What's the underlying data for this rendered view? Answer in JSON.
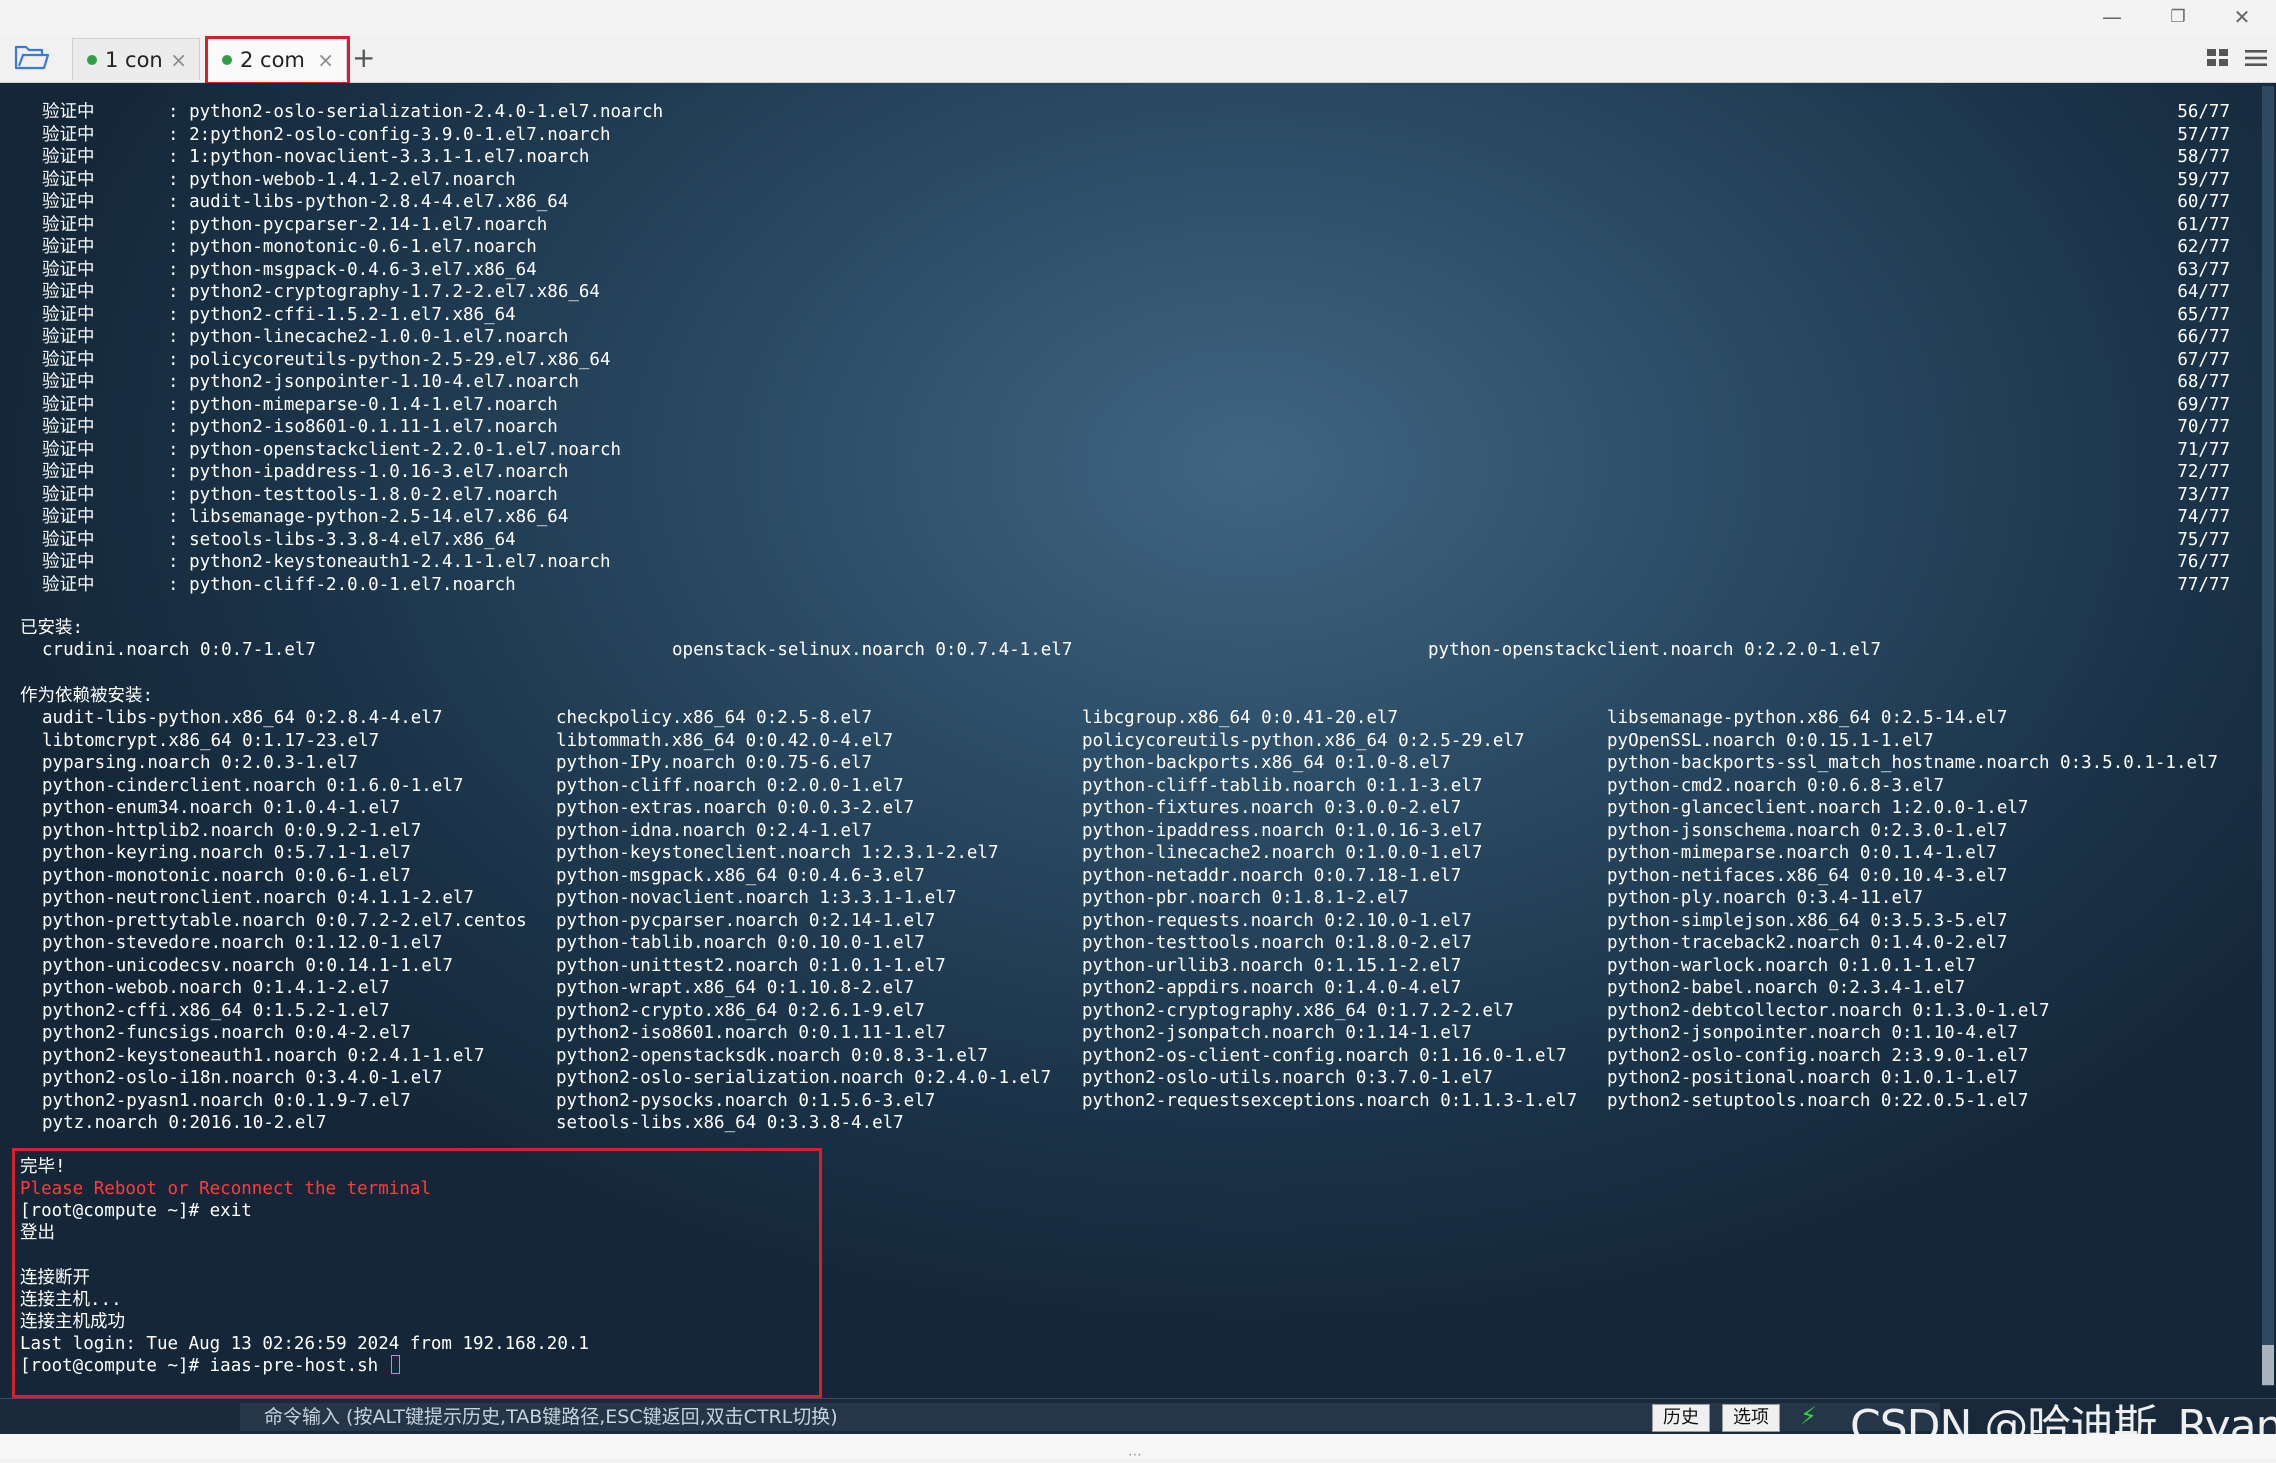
{
  "window": {
    "minimize_icon": "—",
    "restore_icon": "❐",
    "close_icon": "✕"
  },
  "tabs": [
    {
      "label": "1 con",
      "status_color": "#2ea043",
      "active": false
    },
    {
      "label": "2 com",
      "status_color": "#2ea043",
      "active": true
    }
  ],
  "tab_close_glyph": "×",
  "add_tab_glyph": "+",
  "terminal": {
    "verify_lines": [
      {
        "prefix": "验证中",
        "package": ": python2-oslo-serialization-2.4.0-1.el7.noarch",
        "count": "56/77"
      },
      {
        "prefix": "验证中",
        "package": ": 2:python2-oslo-config-3.9.0-1.el7.noarch",
        "count": "57/77"
      },
      {
        "prefix": "验证中",
        "package": ": 1:python-novaclient-3.3.1-1.el7.noarch",
        "count": "58/77"
      },
      {
        "prefix": "验证中",
        "package": ": python-webob-1.4.1-2.el7.noarch",
        "count": "59/77"
      },
      {
        "prefix": "验证中",
        "package": ": audit-libs-python-2.8.4-4.el7.x86_64",
        "count": "60/77"
      },
      {
        "prefix": "验证中",
        "package": ": python-pycparser-2.14-1.el7.noarch",
        "count": "61/77"
      },
      {
        "prefix": "验证中",
        "package": ": python-monotonic-0.6-1.el7.noarch",
        "count": "62/77"
      },
      {
        "prefix": "验证中",
        "package": ": python-msgpack-0.4.6-3.el7.x86_64",
        "count": "63/77"
      },
      {
        "prefix": "验证中",
        "package": ": python2-cryptography-1.7.2-2.el7.x86_64",
        "count": "64/77"
      },
      {
        "prefix": "验证中",
        "package": ": python2-cffi-1.5.2-1.el7.x86_64",
        "count": "65/77"
      },
      {
        "prefix": "验证中",
        "package": ": python-linecache2-1.0.0-1.el7.noarch",
        "count": "66/77"
      },
      {
        "prefix": "验证中",
        "package": ": policycoreutils-python-2.5-29.el7.x86_64",
        "count": "67/77"
      },
      {
        "prefix": "验证中",
        "package": ": python2-jsonpointer-1.10-4.el7.noarch",
        "count": "68/77"
      },
      {
        "prefix": "验证中",
        "package": ": python-mimeparse-0.1.4-1.el7.noarch",
        "count": "69/77"
      },
      {
        "prefix": "验证中",
        "package": ": python2-iso8601-0.1.11-1.el7.noarch",
        "count": "70/77"
      },
      {
        "prefix": "验证中",
        "package": ": python-openstackclient-2.2.0-1.el7.noarch",
        "count": "71/77"
      },
      {
        "prefix": "验证中",
        "package": ": python-ipaddress-1.0.16-3.el7.noarch",
        "count": "72/77"
      },
      {
        "prefix": "验证中",
        "package": ": python-testtools-1.8.0-2.el7.noarch",
        "count": "73/77"
      },
      {
        "prefix": "验证中",
        "package": ": libsemanage-python-2.5-14.el7.x86_64",
        "count": "74/77"
      },
      {
        "prefix": "验证中",
        "package": ": setools-libs-3.3.8-4.el7.x86_64",
        "count": "75/77"
      },
      {
        "prefix": "验证中",
        "package": ": python2-keystoneauth1-2.4.1-1.el7.noarch",
        "count": "76/77"
      },
      {
        "prefix": "验证中",
        "package": ": python-cliff-2.0.0-1.el7.noarch",
        "count": "77/77"
      }
    ],
    "installed_header": "已安装:",
    "installed": [
      "crudini.noarch 0:0.7-1.el7",
      "openstack-selinux.noarch 0:0.7.4-1.el7",
      "python-openstackclient.noarch 0:2.2.0-1.el7"
    ],
    "dependency_header": "作为依赖被安装:",
    "dependency_rows": [
      [
        "audit-libs-python.x86_64 0:2.8.4-4.el7",
        "checkpolicy.x86_64 0:2.5-8.el7",
        "libcgroup.x86_64 0:0.41-20.el7",
        "libsemanage-python.x86_64 0:2.5-14.el7"
      ],
      [
        "libtomcrypt.x86_64 0:1.17-23.el7",
        "libtommath.x86_64 0:0.42.0-4.el7",
        "policycoreutils-python.x86_64 0:2.5-29.el7",
        "pyOpenSSL.noarch 0:0.15.1-1.el7"
      ],
      [
        "pyparsing.noarch 0:2.0.3-1.el7",
        "python-IPy.noarch 0:0.75-6.el7",
        "python-backports.x86_64 0:1.0-8.el7",
        "python-backports-ssl_match_hostname.noarch 0:3.5.0.1-1.el7"
      ],
      [
        "python-cinderclient.noarch 0:1.6.0-1.el7",
        "python-cliff.noarch 0:2.0.0-1.el7",
        "python-cliff-tablib.noarch 0:1.1-3.el7",
        "python-cmd2.noarch 0:0.6.8-3.el7"
      ],
      [
        "python-enum34.noarch 0:1.0.4-1.el7",
        "python-extras.noarch 0:0.0.3-2.el7",
        "python-fixtures.noarch 0:3.0.0-2.el7",
        "python-glanceclient.noarch 1:2.0.0-1.el7"
      ],
      [
        "python-httplib2.noarch 0:0.9.2-1.el7",
        "python-idna.noarch 0:2.4-1.el7",
        "python-ipaddress.noarch 0:1.0.16-3.el7",
        "python-jsonschema.noarch 0:2.3.0-1.el7"
      ],
      [
        "python-keyring.noarch 0:5.7.1-1.el7",
        "python-keystoneclient.noarch 1:2.3.1-2.el7",
        "python-linecache2.noarch 0:1.0.0-1.el7",
        "python-mimeparse.noarch 0:0.1.4-1.el7"
      ],
      [
        "python-monotonic.noarch 0:0.6-1.el7",
        "python-msgpack.x86_64 0:0.4.6-3.el7",
        "python-netaddr.noarch 0:0.7.18-1.el7",
        "python-netifaces.x86_64 0:0.10.4-3.el7"
      ],
      [
        "python-neutronclient.noarch 0:4.1.1-2.el7",
        "python-novaclient.noarch 1:3.3.1-1.el7",
        "python-pbr.noarch 0:1.8.1-2.el7",
        "python-ply.noarch 0:3.4-11.el7"
      ],
      [
        "python-prettytable.noarch 0:0.7.2-2.el7.centos",
        "python-pycparser.noarch 0:2.14-1.el7",
        "python-requests.noarch 0:2.10.0-1.el7",
        "python-simplejson.x86_64 0:3.5.3-5.el7"
      ],
      [
        "python-stevedore.noarch 0:1.12.0-1.el7",
        "python-tablib.noarch 0:0.10.0-1.el7",
        "python-testtools.noarch 0:1.8.0-2.el7",
        "python-traceback2.noarch 0:1.4.0-2.el7"
      ],
      [
        "python-unicodecsv.noarch 0:0.14.1-1.el7",
        "python-unittest2.noarch 0:1.0.1-1.el7",
        "python-urllib3.noarch 0:1.15.1-2.el7",
        "python-warlock.noarch 0:1.0.1-1.el7"
      ],
      [
        "python-webob.noarch 0:1.4.1-2.el7",
        "python-wrapt.x86_64 0:1.10.8-2.el7",
        "python2-appdirs.noarch 0:1.4.0-4.el7",
        "python2-babel.noarch 0:2.3.4-1.el7"
      ],
      [
        "python2-cffi.x86_64 0:1.5.2-1.el7",
        "python2-crypto.x86_64 0:2.6.1-9.el7",
        "python2-cryptography.x86_64 0:1.7.2-2.el7",
        "python2-debtcollector.noarch 0:1.3.0-1.el7"
      ],
      [
        "python2-funcsigs.noarch 0:0.4-2.el7",
        "python2-iso8601.noarch 0:0.1.11-1.el7",
        "python2-jsonpatch.noarch 0:1.14-1.el7",
        "python2-jsonpointer.noarch 0:1.10-4.el7"
      ],
      [
        "python2-keystoneauth1.noarch 0:2.4.1-1.el7",
        "python2-openstacksdk.noarch 0:0.8.3-1.el7",
        "python2-os-client-config.noarch 0:1.16.0-1.el7",
        "python2-oslo-config.noarch 2:3.9.0-1.el7"
      ],
      [
        "python2-oslo-i18n.noarch 0:3.4.0-1.el7",
        "python2-oslo-serialization.noarch 0:2.4.0-1.el7",
        "python2-oslo-utils.noarch 0:3.7.0-1.el7",
        "python2-positional.noarch 0:1.0.1-1.el7"
      ],
      [
        "python2-pyasn1.noarch 0:0.1.9-7.el7",
        "python2-pysocks.noarch 0:1.5.6-3.el7",
        "python2-requestsexceptions.noarch 0:1.1.3-1.el7",
        "python2-setuptools.noarch 0:22.0.5-1.el7"
      ],
      [
        "pytz.noarch 0:2016.10-2.el7",
        "setools-libs.x86_64 0:3.3.8-4.el7",
        "",
        ""
      ]
    ],
    "tail": {
      "done": "完毕!",
      "reboot_warning": "Please Reboot or Reconnect the terminal",
      "exit_cmd": "[root@compute ~]# exit",
      "logout": "登出",
      "disconnected": "连接断开",
      "connecting": "连接主机...",
      "connected": "连接主机成功",
      "last_login": "Last login: Tue Aug 13 02:26:59 2024 from 192.168.20.1",
      "prompt": "[root@compute ~]# iaas-pre-host.sh "
    }
  },
  "command_bar": {
    "hint": "命令输入 (按ALT键提示历史,TAB键路径,ESC键返回,双击CTRL切换)",
    "history_label": "历史",
    "options_label": "选项"
  },
  "watermark": "CSDN @哈迪斯_Ryan"
}
